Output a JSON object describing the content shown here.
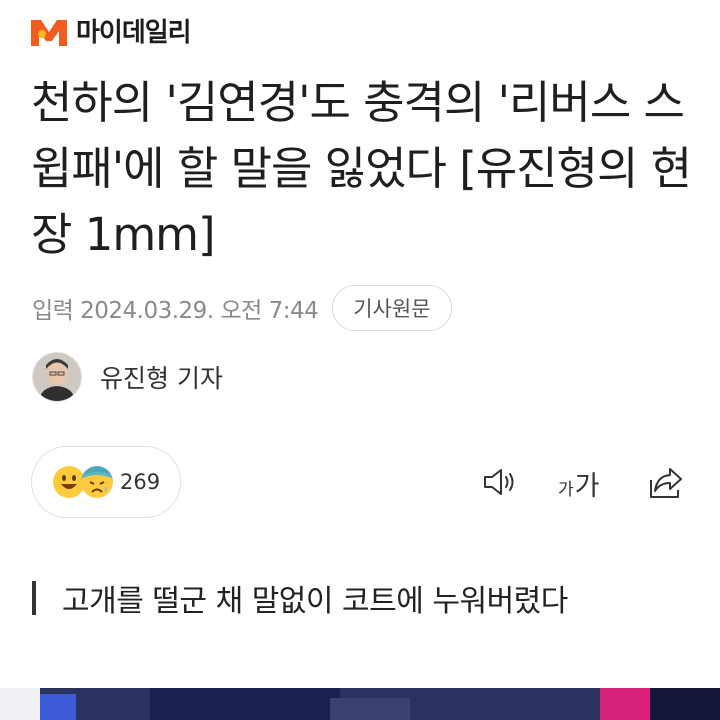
{
  "brand": {
    "name": "마이데일리",
    "accent": "#f25a1e"
  },
  "article": {
    "headline": "천하의 '김연경'도 충격의 '리버스 스윕패'에 할 말을 잃었다 [유진형의 현장 1mm]",
    "date": "입력 2024.03.29. 오전 7:44",
    "source_button": "기사원문",
    "reporter": "유진형 기자",
    "subheadline": "고개를 떨군 채 말없이 코트에 누워버렸다"
  },
  "actions": {
    "reaction_count": "269",
    "reaction_icons": [
      "smile-emoji-icon",
      "sad-emoji-icon"
    ],
    "listen_icon": "speaker-icon",
    "font_size_small": "가",
    "font_size_large": "가",
    "share_icon": "share-icon"
  }
}
